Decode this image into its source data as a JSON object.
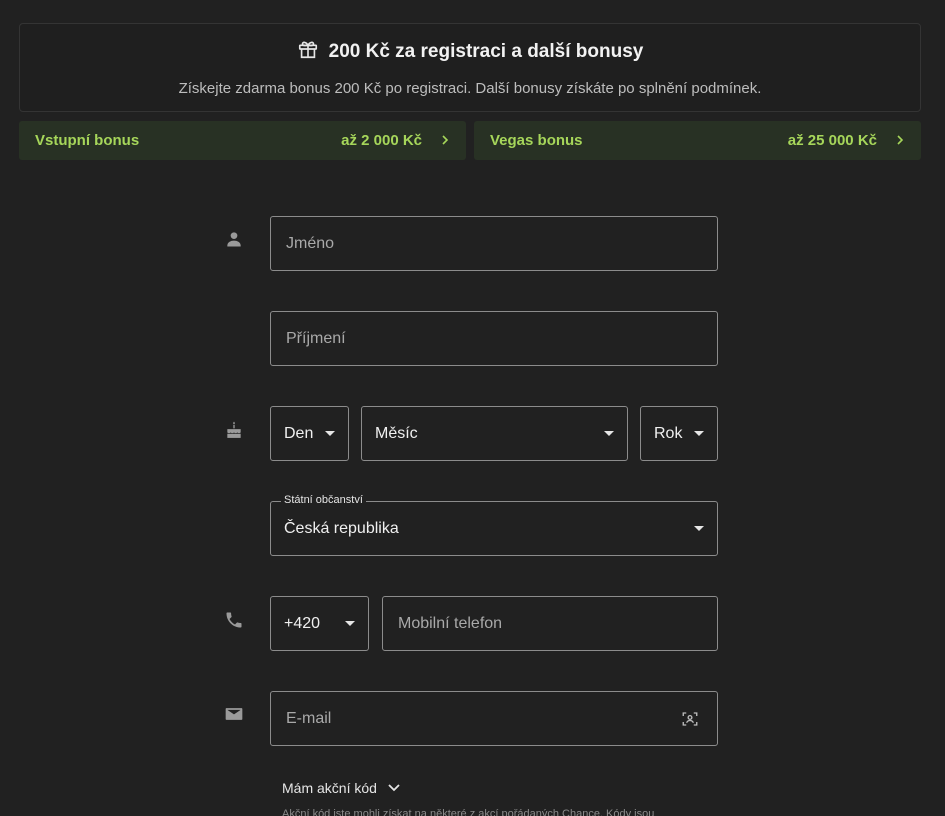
{
  "promo": {
    "title": "200 Kč za registraci a další bonusy",
    "text": "Získejte zdarma bonus 200 Kč po registraci. Další bonusy získáte po splnění podmínek.",
    "icon": "gift-icon"
  },
  "bonuses": [
    {
      "name": "Vstupní bonus",
      "amount": "až 2 000 Kč"
    },
    {
      "name": "Vegas bonus",
      "amount": "až 25 000 Kč"
    }
  ],
  "form": {
    "first_name": {
      "placeholder": "Jméno",
      "value": ""
    },
    "last_name": {
      "placeholder": "Příjmení",
      "value": ""
    },
    "birth_day": "Den",
    "birth_month": "Měsíc",
    "birth_year": "Rok",
    "citizenship": {
      "label": "Státní občanství",
      "value": "Česká republika"
    },
    "phone_prefix": "+420",
    "phone": {
      "placeholder": "Mobilní telefon",
      "value": ""
    },
    "email": {
      "placeholder": "E-mail",
      "value": ""
    },
    "promo_code_toggle": "Mám akční kód",
    "promo_code_hint": "Akční kód jste mohli získat na některé z akcí pořádaných Chance. Kódy jsou"
  },
  "colors": {
    "background": "#212121",
    "accent_green": "#a6d65a",
    "bonus_bg": "#283124"
  }
}
